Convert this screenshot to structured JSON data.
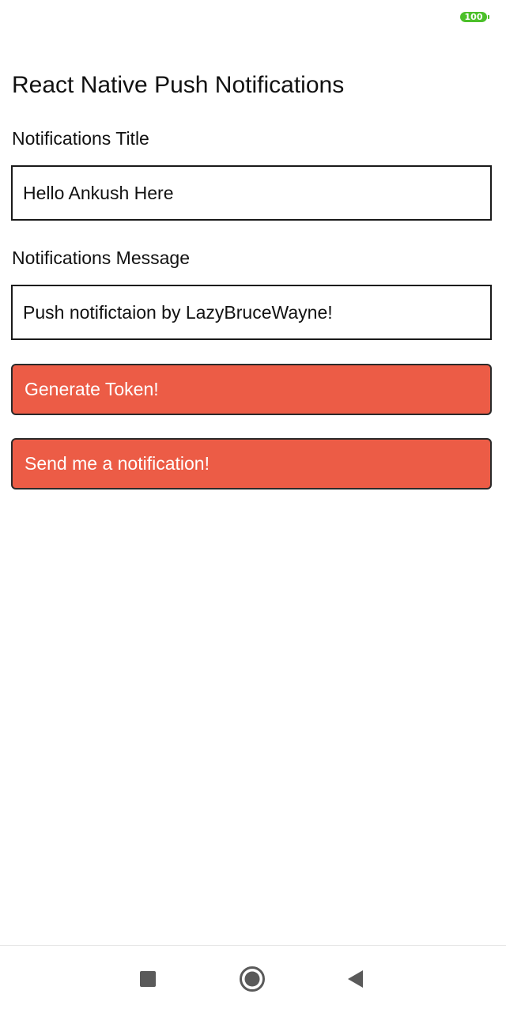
{
  "status_bar": {
    "battery_level": "100",
    "battery_color": "#4cc02a"
  },
  "screen": {
    "title": "React Native Push Notifications"
  },
  "form": {
    "title_label": "Notifications Title",
    "title_value": "Hello Ankush Here",
    "message_label": "Notifications Message",
    "message_value": "Push notifictaion by LazyBruceWayne!"
  },
  "buttons": {
    "generate_token_label": "Generate Token!",
    "send_notification_label": "Send me a notification!",
    "accent_color": "#ec5c46"
  },
  "nav_bar": {
    "recent_icon": "square-icon",
    "home_icon": "circle-home-icon",
    "back_icon": "triangle-back-icon"
  }
}
